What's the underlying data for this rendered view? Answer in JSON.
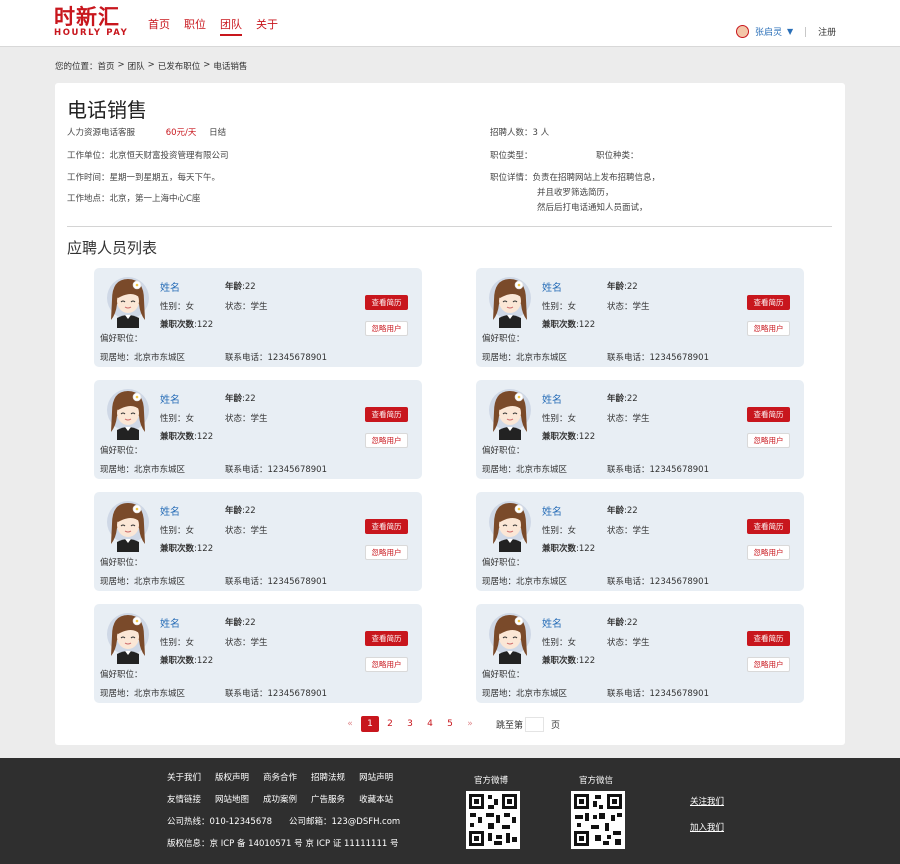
{
  "header": {
    "logo_cn": "时新汇",
    "logo_en": "HOURLY PAY",
    "nav": [
      "首页",
      "职位",
      "团队",
      "关于"
    ],
    "user_name": "张启灵",
    "register": "注册"
  },
  "breadcrumb": [
    "您的位置：首页",
    ">",
    "团队",
    ">",
    "已发布职位",
    ">",
    "电话销售"
  ],
  "job": {
    "title": "电话销售",
    "type": "人力资源电话客服",
    "salary": "60元/天",
    "settle": "日结",
    "company": "工作单位：北京恒天财富投资管理有限公司",
    "time": "工作时间：星期一到星期五，每天下午。",
    "location": "工作地点：北京，第一上海中心C座",
    "recruit": "招聘人数：3 人",
    "category": "职位类型：",
    "kind": "职位种类：",
    "detail1": "职位详情：负责在招聘网站上发布招聘信息，",
    "detail2": "并且收罗筛选简历，",
    "detail3": "然后后打电话通知人员面试，"
  },
  "list_title": "应聘人员列表",
  "applicants": [
    {
      "name": "姓名",
      "age_label": "年龄",
      "age": ":22",
      "gender": "性别：女",
      "status": "状态：学生",
      "count_label": "兼职次数",
      "count": ":122",
      "pref": "偏好职位：",
      "addr": "现居地：北京市东城区",
      "phone": "联系电话：12345678901",
      "btn_resume": "查看简历",
      "btn_ignore": "忽略用户"
    },
    {
      "name": "姓名",
      "age_label": "年龄",
      "age": ":22",
      "gender": "性别：女",
      "status": "状态：学生",
      "count_label": "兼职次数",
      "count": ":122",
      "pref": "偏好职位：",
      "addr": "现居地：北京市东城区",
      "phone": "联系电话：12345678901",
      "btn_resume": "查看简历",
      "btn_ignore": "忽略用户"
    },
    {
      "name": "姓名",
      "age_label": "年龄",
      "age": ":22",
      "gender": "性别：女",
      "status": "状态：学生",
      "count_label": "兼职次数",
      "count": ":122",
      "pref": "偏好职位：",
      "addr": "现居地：北京市东城区",
      "phone": "联系电话：12345678901",
      "btn_resume": "查看简历",
      "btn_ignore": "忽略用户"
    },
    {
      "name": "姓名",
      "age_label": "年龄",
      "age": ":22",
      "gender": "性别：女",
      "status": "状态：学生",
      "count_label": "兼职次数",
      "count": ":122",
      "pref": "偏好职位：",
      "addr": "现居地：北京市东城区",
      "phone": "联系电话：12345678901",
      "btn_resume": "查看简历",
      "btn_ignore": "忽略用户"
    },
    {
      "name": "姓名",
      "age_label": "年龄",
      "age": ":22",
      "gender": "性别：女",
      "status": "状态：学生",
      "count_label": "兼职次数",
      "count": ":122",
      "pref": "偏好职位：",
      "addr": "现居地：北京市东城区",
      "phone": "联系电话：12345678901",
      "btn_resume": "查看简历",
      "btn_ignore": "忽略用户"
    },
    {
      "name": "姓名",
      "age_label": "年龄",
      "age": ":22",
      "gender": "性别：女",
      "status": "状态：学生",
      "count_label": "兼职次数",
      "count": ":122",
      "pref": "偏好职位：",
      "addr": "现居地：北京市东城区",
      "phone": "联系电话：12345678901",
      "btn_resume": "查看简历",
      "btn_ignore": "忽略用户"
    },
    {
      "name": "姓名",
      "age_label": "年龄",
      "age": ":22",
      "gender": "性别：女",
      "status": "状态：学生",
      "count_label": "兼职次数",
      "count": ":122",
      "pref": "偏好职位：",
      "addr": "现居地：北京市东城区",
      "phone": "联系电话：12345678901",
      "btn_resume": "查看简历",
      "btn_ignore": "忽略用户"
    },
    {
      "name": "姓名",
      "age_label": "年龄",
      "age": ":22",
      "gender": "性别：女",
      "status": "状态：学生",
      "count_label": "兼职次数",
      "count": ":122",
      "pref": "偏好职位：",
      "addr": "现居地：北京市东城区",
      "phone": "联系电话：12345678901",
      "btn_resume": "查看简历",
      "btn_ignore": "忽略用户"
    }
  ],
  "pager": {
    "prev": "«",
    "pages": [
      "1",
      "2",
      "3",
      "4",
      "5"
    ],
    "current": "1",
    "next": "»",
    "jump_label": "跳至第",
    "jump_unit": "页"
  },
  "footer": {
    "row1": [
      "关于我们",
      "版权声明",
      "商务合作",
      "招聘法规",
      "网站声明"
    ],
    "row2": [
      "友情链接",
      "网站地图",
      "成功案例",
      "广告服务",
      "收藏本站"
    ],
    "contact": "公司热线：010-12345678　　公司邮箱：123@DSFH.com",
    "copyright": "版权信息：京 ICP 备 14010571 号 京 ICP 证 11111111 号",
    "weibo": "官方微博",
    "weixin": "官方微信",
    "follow": "关注我们",
    "join": "加入我们"
  }
}
